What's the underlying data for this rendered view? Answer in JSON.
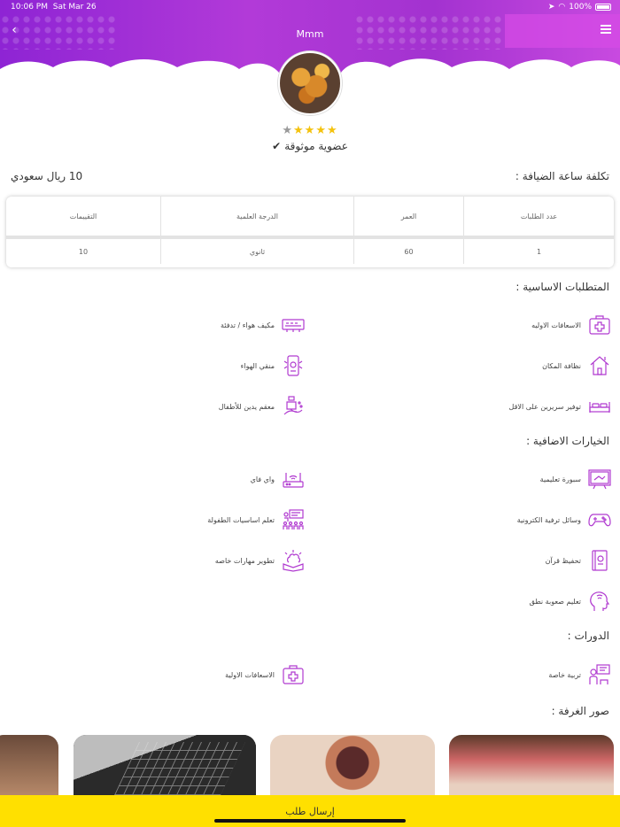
{
  "status": {
    "time": "10:06 PM",
    "date": "Sat Mar 26",
    "battery": "100%"
  },
  "header": {
    "title": "Mmm"
  },
  "profile": {
    "rating": 4,
    "rating_max": 5,
    "membership": "عضوية موثوقة"
  },
  "cost": {
    "label": "تكلفة ساعة الضيافة :",
    "value": "10 ريال سعودي"
  },
  "table": {
    "headers": [
      "عدد الطلبات",
      "العمر",
      "الدرجة العلمية",
      "التقييمات"
    ],
    "values": [
      "1",
      "60",
      "ثانوي",
      "10"
    ]
  },
  "sections": {
    "basic": "المتطلبات الاساسية :",
    "extra": "الخيارات الاضافية :",
    "courses": "الدورات :",
    "photos": "صور الغرفة :"
  },
  "basic_features": [
    {
      "label": "الاسعافات الاوليه",
      "icon": "first-aid-icon"
    },
    {
      "label": "مكيف هواء / تدفئة",
      "icon": "air-conditioner-icon"
    },
    {
      "label": "نظافة المكان",
      "icon": "clean-house-icon"
    },
    {
      "label": "منقي الهواء",
      "icon": "air-purifier-icon"
    },
    {
      "label": "توفير سريرين على الاقل",
      "icon": "bed-icon"
    },
    {
      "label": "معقم يدين للأطفال",
      "icon": "hand-sanitizer-icon"
    }
  ],
  "extra_features": [
    {
      "label": "سبورة تعليمية",
      "icon": "whiteboard-icon"
    },
    {
      "label": "واي فاي",
      "icon": "wifi-router-icon"
    },
    {
      "label": "وسائل ترفية الكترونية",
      "icon": "gamepad-icon"
    },
    {
      "label": "تعلم اساسيات الطفولة",
      "icon": "classroom-icon"
    },
    {
      "label": "تحفيظ قرآن",
      "icon": "quran-icon"
    },
    {
      "label": "تطوير مهارات خاصه",
      "icon": "brain-book-icon"
    },
    {
      "label": "تعليم صعوبة نطق",
      "icon": "speech-icon"
    }
  ],
  "courses": [
    {
      "label": "تربية خاصة",
      "icon": "teacher-icon"
    },
    {
      "label": "الاسعافات الاولية",
      "icon": "first-aid-icon"
    }
  ],
  "send_button": "إرسال طلب",
  "colors": {
    "header": "#a332d0",
    "icon": "#b03ad0",
    "send": "#ffe000",
    "star": "#f4c20d"
  }
}
